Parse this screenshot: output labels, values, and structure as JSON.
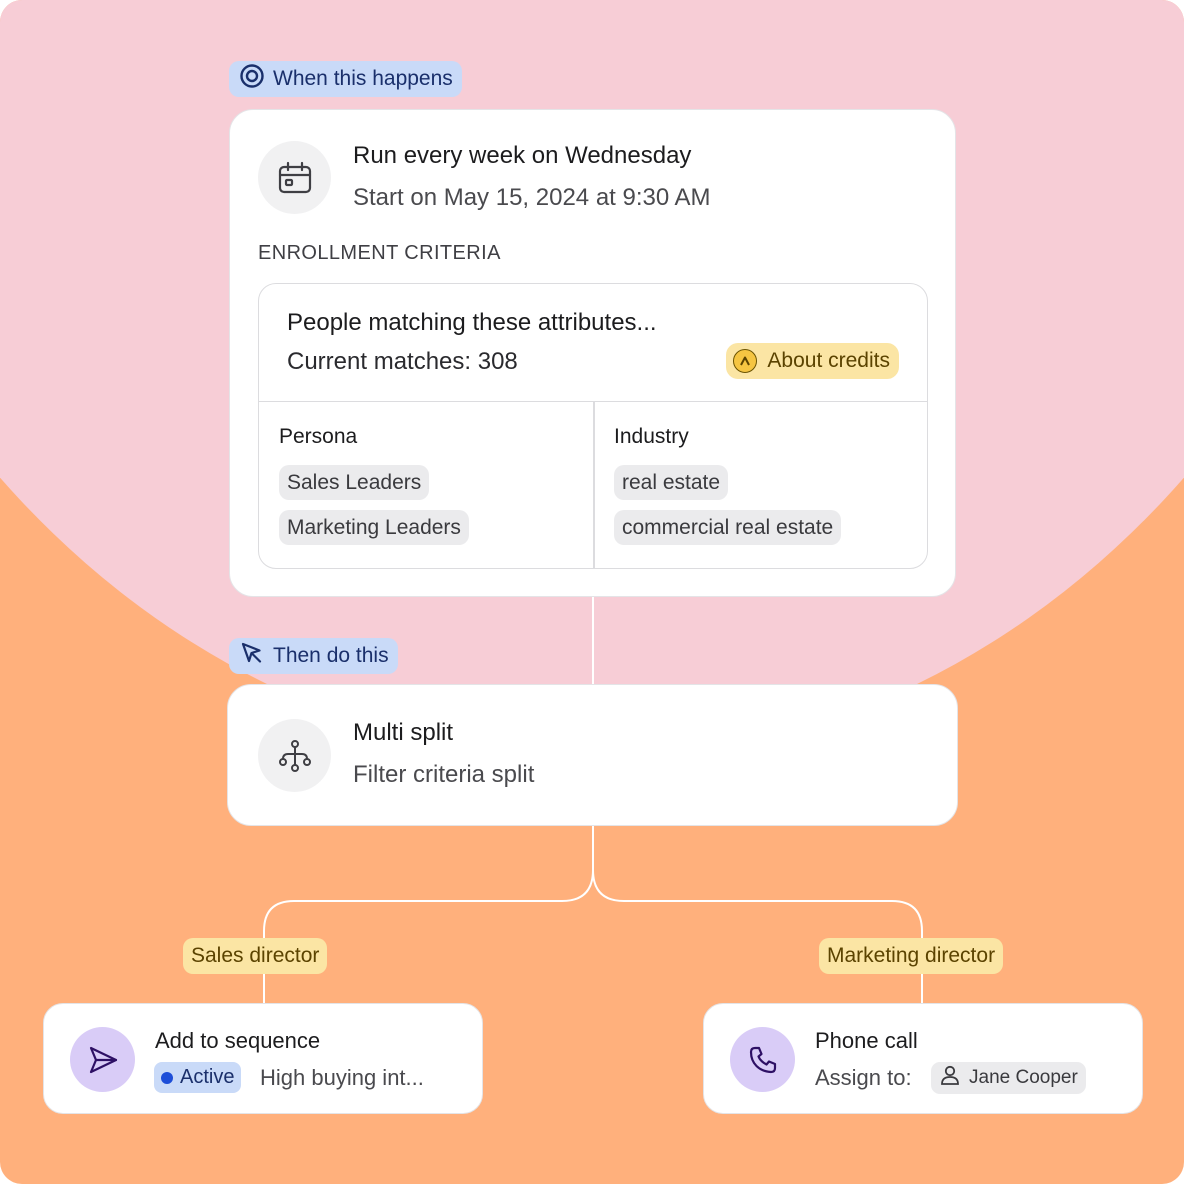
{
  "colors": {
    "pink_background": "#f7cdd6",
    "orange_background": "#ffb07c",
    "trigger_label": "#c9daf8",
    "branch_label": "#fbe5a4",
    "action_icon": "#d9ccf7"
  },
  "trigger": {
    "label": "When this happens",
    "icon": "target-icon",
    "title": "Run every week on Wednesday",
    "subtitle": "Start on May 15, 2024 at 9:30 AM",
    "schedule_icon": "calendar-icon",
    "criteria_heading": "ENROLLMENT CRITERIA",
    "criteria": {
      "title": "People matching these attributes...",
      "matches": "Current matches: 308",
      "credits_label": "About credits",
      "credits_icon": "credits-icon",
      "columns": [
        {
          "title": "Persona",
          "values": [
            "Sales Leaders",
            "Marketing Leaders"
          ]
        },
        {
          "title": "Industry",
          "values": [
            "real estate",
            "commercial real estate"
          ]
        }
      ]
    }
  },
  "action": {
    "label": "Then do this",
    "icon": "cursor-icon",
    "title": "Multi split",
    "subtitle": "Filter criteria split",
    "split_icon": "split-icon"
  },
  "branches": [
    {
      "label": "Sales director",
      "title": "Add to sequence",
      "icon": "send-icon",
      "status": "Active",
      "detail": "High buying int..."
    },
    {
      "label": "Marketing director",
      "title": "Phone call",
      "icon": "phone-icon",
      "assign_label": "Assign to:",
      "assignee": "Jane Cooper",
      "assignee_icon": "user-icon"
    }
  ]
}
